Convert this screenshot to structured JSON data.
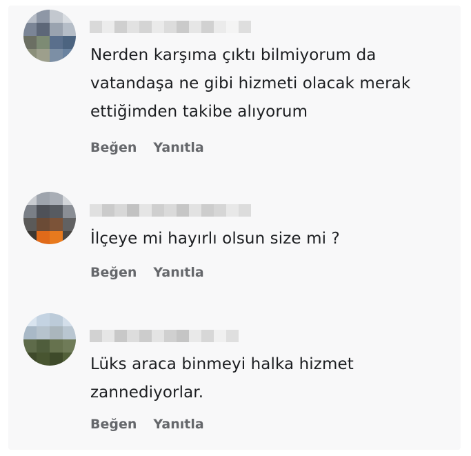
{
  "comments": [
    {
      "author": "",
      "text": "Nerden karşıma çıktı bilmiyorum da vatandaşa ne gibi hizmeti olacak merak ettiğimden takibe alıyorum",
      "like_label": "Beğen",
      "reply_label": "Yanıtla"
    },
    {
      "author": "",
      "text": "İlçeye mi hayırlı olsun size mi ?",
      "like_label": "Beğen",
      "reply_label": "Yanıtla"
    },
    {
      "author": "",
      "text": "Lüks araca binmeyi halka hizmet zannediyorlar.",
      "like_label": "Beğen",
      "reply_label": "Yanıtla"
    }
  ],
  "colors": {
    "background": "#f8f8f9",
    "text": "#1c1e21",
    "action_text": "#65676b"
  }
}
